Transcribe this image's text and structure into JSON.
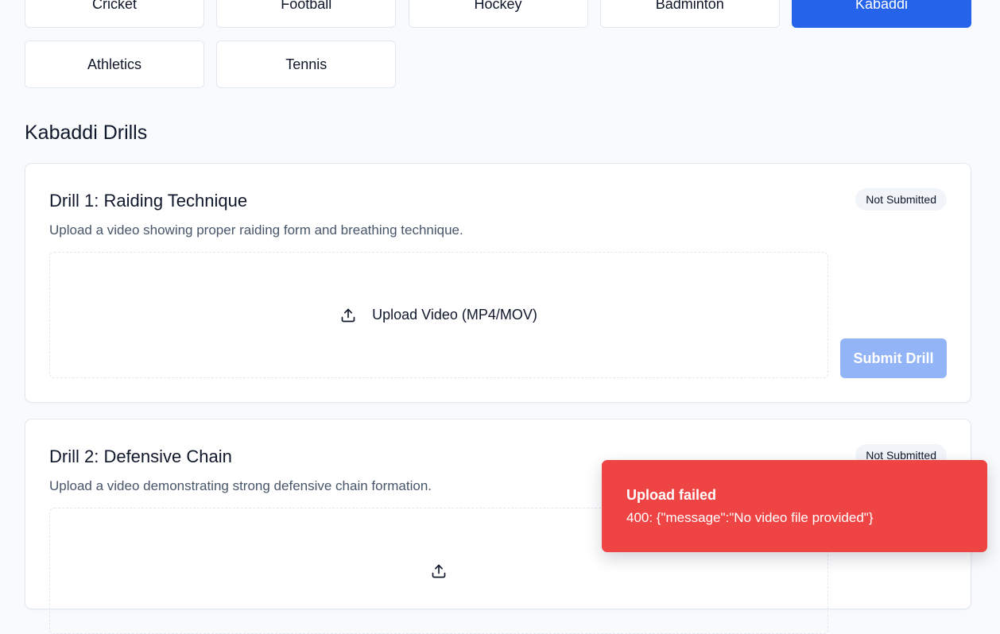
{
  "sports": {
    "items": [
      {
        "label": "Cricket",
        "active": false
      },
      {
        "label": "Football",
        "active": false
      },
      {
        "label": "Hockey",
        "active": false
      },
      {
        "label": "Badminton",
        "active": false
      },
      {
        "label": "Kabaddi",
        "active": true
      },
      {
        "label": "Athletics",
        "active": false
      },
      {
        "label": "Tennis",
        "active": false
      }
    ],
    "active_color": "#2563eb"
  },
  "section": {
    "title": "Kabaddi Drills"
  },
  "drills": [
    {
      "title": "Drill 1: Raiding Technique",
      "description": "Upload a video showing proper raiding form and breathing technique.",
      "status": "Not Submitted",
      "upload_label": "Upload Video (MP4/MOV)",
      "upload_icon": "upload-icon",
      "submit_label": "Submit Drill",
      "submit_disabled": true
    },
    {
      "title": "Drill 2: Defensive Chain",
      "description": "Upload a video demonstrating strong defensive chain formation.",
      "status": "Not Submitted",
      "upload_icon": "upload-icon"
    }
  ],
  "toast": {
    "title": "Upload failed",
    "message": "400: {\"message\":\"No video file provided\"}",
    "color": "#ef4444"
  }
}
